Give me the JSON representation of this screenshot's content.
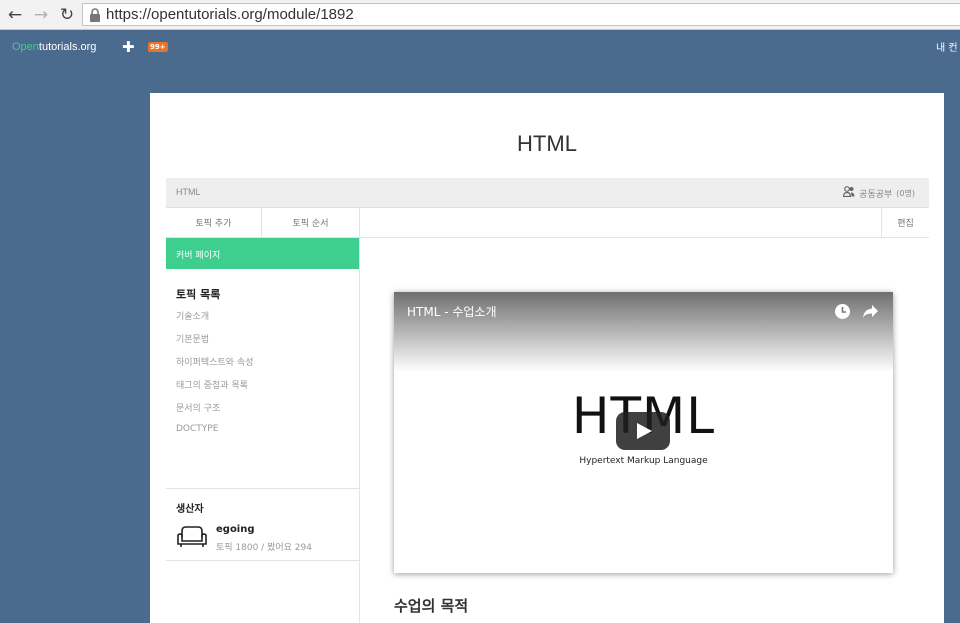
{
  "browser": {
    "url_prefix": "https://",
    "url_host": "opentutorials.org",
    "url_path": "/module/1892"
  },
  "site": {
    "logo_open": "Open",
    "logo_rest": "tutorials.org",
    "plus": "✚",
    "notifications": "99+",
    "my_content": "내 컨"
  },
  "page": {
    "title": "HTML",
    "breadcrumb": "HTML",
    "study_label": "공동공부",
    "study_count": "(0명)"
  },
  "toolbar": {
    "add_topic": "토픽 추가",
    "topic_order": "토픽 순서",
    "edit": "편집"
  },
  "sidebar": {
    "cover_page": "커버 페이지",
    "topics_heading": "토픽 목록",
    "topics": [
      "기술소개",
      "기본문법",
      "하이퍼텍스트와 속성",
      "태그의 중첩과 목록",
      "문서의 구조",
      "DOCTYPE"
    ],
    "creator_heading": "생산자",
    "author_name": "egoing",
    "author_stats": "토픽 1800 / 봤어요 294"
  },
  "video": {
    "title": "HTML - 수업소개",
    "logo_text": "HTML",
    "subtitle": "Hypertext Markup Language"
  },
  "content": {
    "section_title": "수업의 목적"
  },
  "colors": {
    "accent": "#3ecf8e",
    "background": "#4a6a8e",
    "badge": "#e8732a"
  }
}
